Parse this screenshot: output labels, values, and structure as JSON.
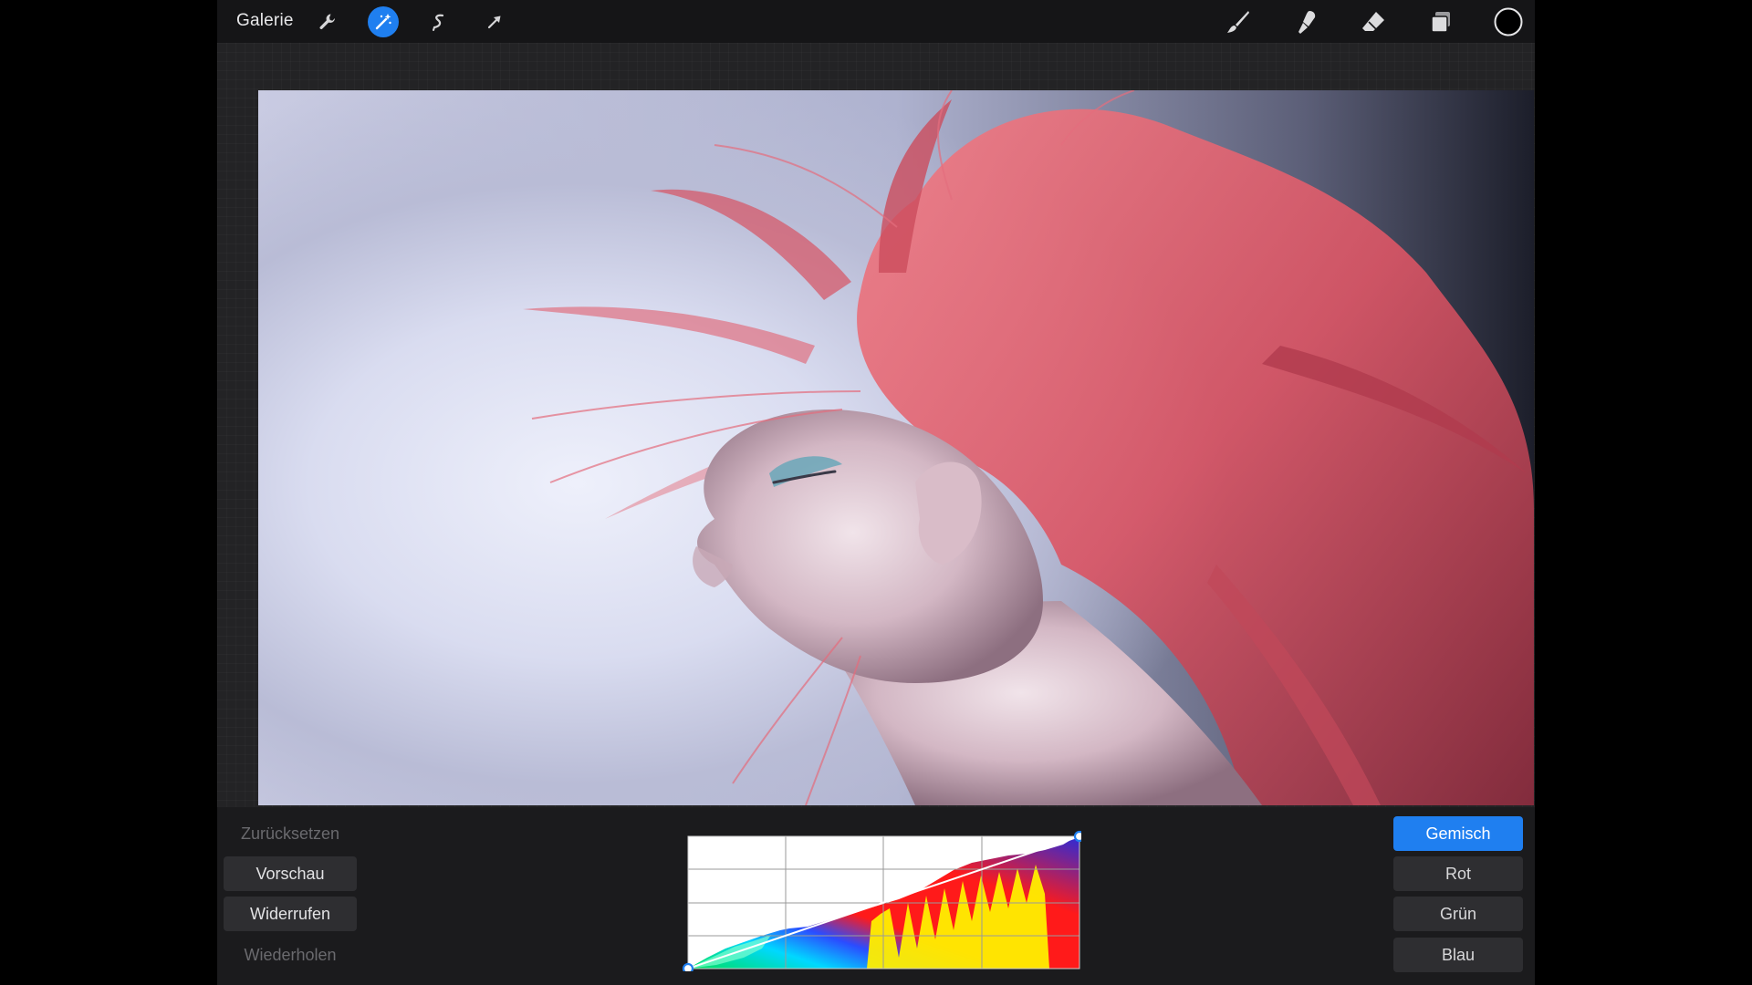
{
  "toolbar": {
    "gallery_label": "Galerie",
    "left_icons": [
      "wrench-icon",
      "magic-wand-icon",
      "selection-icon",
      "transform-arrow-icon"
    ],
    "right_icons": [
      "brush-icon",
      "smudge-icon",
      "eraser-icon",
      "layers-icon",
      "color-swatch-icon"
    ],
    "active_tool": "magic-wand-icon",
    "accent_color": "#1f7ff0",
    "current_color": "#000000"
  },
  "canvas": {
    "image_description_icon": "photo-canvas"
  },
  "curves_panel": {
    "left_buttons": {
      "reset": "Zurücksetzen",
      "preview": "Vorschau",
      "undo": "Widerrufen",
      "redo": "Wiederholen"
    },
    "channels": {
      "composite": "Gemisch",
      "red": "Rot",
      "green": "Grün",
      "blue": "Blau"
    },
    "selected_channel": "Gemisch",
    "curve_points": [
      [
        0,
        0
      ],
      [
        1,
        1
      ]
    ]
  }
}
